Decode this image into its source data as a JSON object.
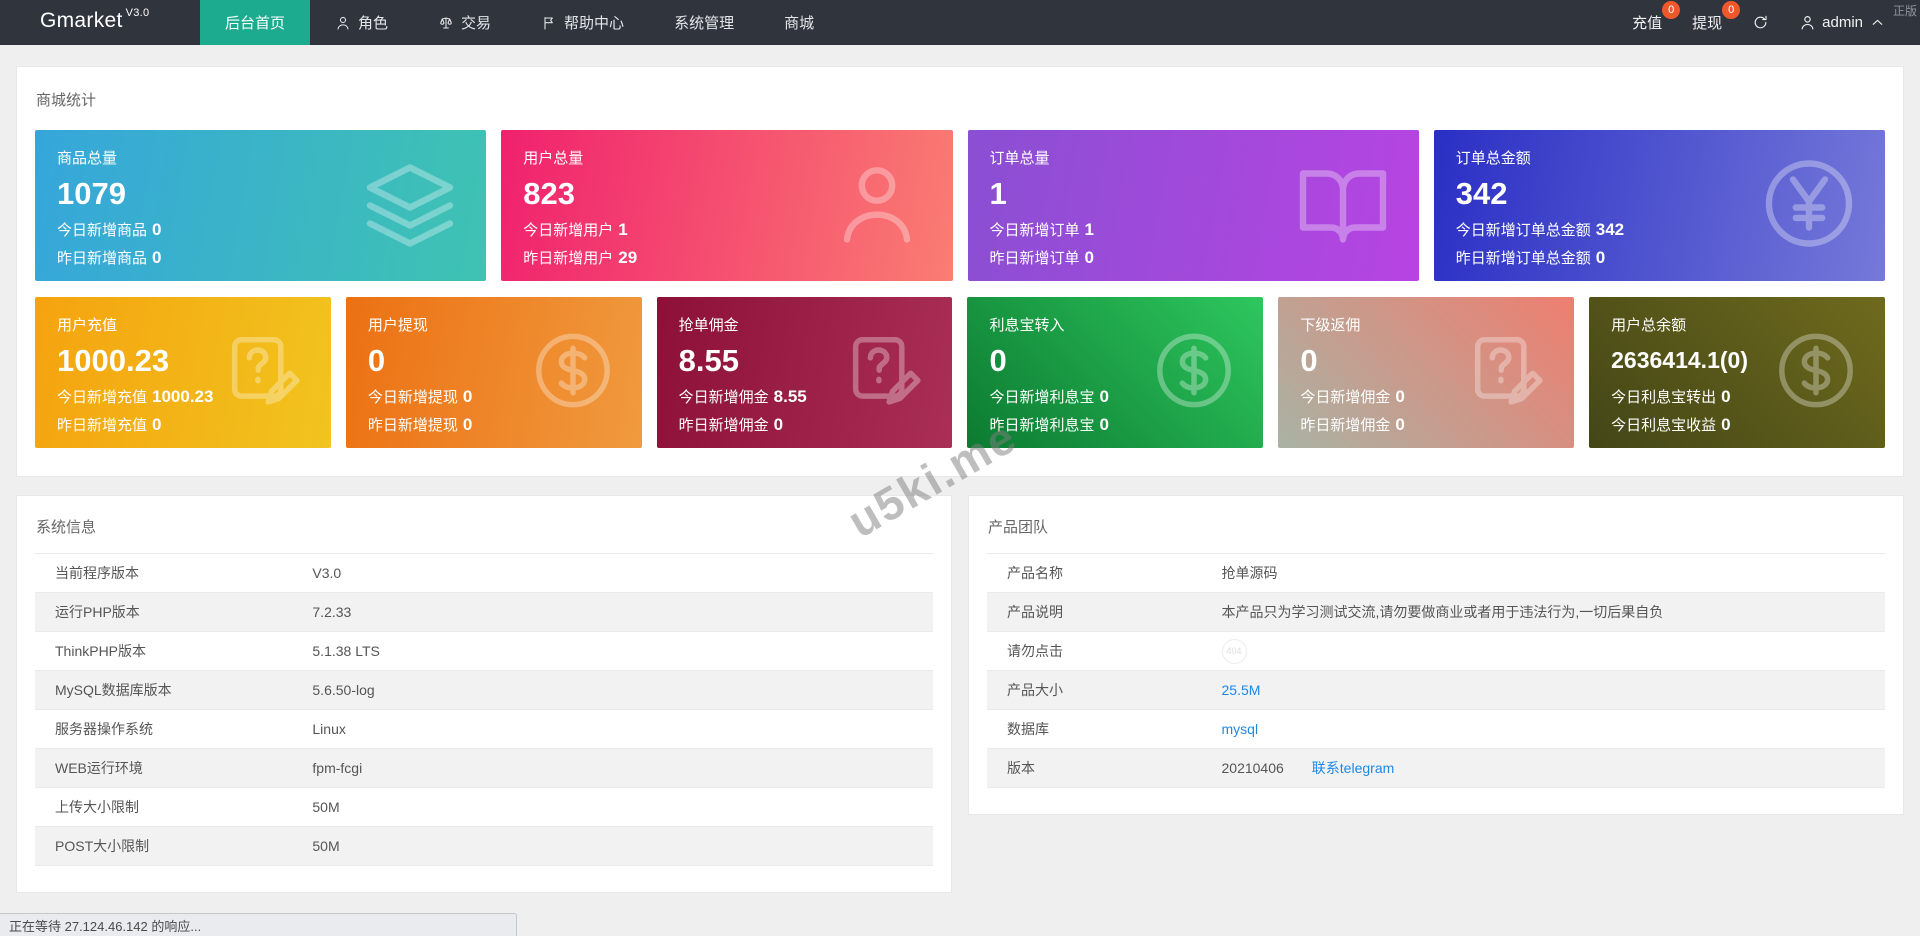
{
  "navbar": {
    "brand": "Gmarket",
    "version": "V3.0",
    "items": [
      {
        "label": "后台首页",
        "icon": null,
        "active": true
      },
      {
        "label": "角色",
        "icon": "user-icon",
        "active": false
      },
      {
        "label": "交易",
        "icon": "scales-icon",
        "active": false
      },
      {
        "label": "帮助中心",
        "icon": "flag-icon",
        "active": false
      },
      {
        "label": "系统管理",
        "icon": null,
        "active": false
      },
      {
        "label": "商城",
        "icon": null,
        "active": false
      }
    ],
    "recharge_label": "充值",
    "recharge_badge": "0",
    "withdraw_label": "提现",
    "withdraw_badge": "0",
    "username": "admin",
    "corner_text": "正版"
  },
  "stats": {
    "title": "商城统计",
    "row1": [
      {
        "title": "商品总量",
        "value": "1079",
        "today_label": "今日新增商品",
        "today_value": "0",
        "yesterday_label": "昨日新增商品",
        "yesterday_value": "0",
        "icon": "layers-icon",
        "gradient": "linear-gradient(100deg,#36a6db,#3fc3b2)"
      },
      {
        "title": "用户总量",
        "value": "823",
        "today_label": "今日新增用户",
        "today_value": "1",
        "yesterday_label": "昨日新增用户",
        "yesterday_value": "29",
        "icon": "person-icon",
        "gradient": "linear-gradient(100deg,#f0216e,#fa7d72)"
      },
      {
        "title": "订单总量",
        "value": "1",
        "today_label": "今日新增订单",
        "today_value": "1",
        "yesterday_label": "昨日新增订单",
        "yesterday_value": "0",
        "icon": "book-icon",
        "gradient": "linear-gradient(100deg,#8a4fd3,#b744e2)"
      },
      {
        "title": "订单总金额",
        "value": "342",
        "today_label": "今日新增订单总金额",
        "today_value": "342",
        "yesterday_label": "昨日新增订单总金额",
        "yesterday_value": "0",
        "icon": "yen-circle-icon",
        "gradient": "linear-gradient(100deg,#2a2fc5,#7579d9)"
      }
    ],
    "row2": [
      {
        "title": "用户充值",
        "value": "1000.23",
        "today_label": "今日新增充值",
        "today_value": "1000.23",
        "yesterday_label": "昨日新增充值",
        "yesterday_value": "0",
        "icon": "clipboard-question-icon",
        "gradient": "linear-gradient(100deg,#f5a30f,#f1c41e)"
      },
      {
        "title": "用户提现",
        "value": "0",
        "today_label": "今日新增提现",
        "today_value": "0",
        "yesterday_label": "昨日新增提现",
        "yesterday_value": "0",
        "icon": "dollar-circle-icon",
        "gradient": "linear-gradient(100deg,#ec7113,#f09a3e)"
      },
      {
        "title": "抢单佣金",
        "value": "8.55",
        "today_label": "今日新增佣金",
        "today_value": "8.55",
        "yesterday_label": "昨日新增佣金",
        "yesterday_value": "0",
        "icon": "clipboard-question-icon",
        "gradient": "linear-gradient(100deg,#8c1038,#aa2f56)"
      },
      {
        "title": "利息宝转入",
        "value": "0",
        "today_label": "今日新增利息宝",
        "today_value": "0",
        "yesterday_label": "昨日新增利息宝",
        "yesterday_value": "0",
        "icon": "dollar-circle-icon",
        "gradient": "linear-gradient(45deg,#0c7a31,#2ec75e)"
      },
      {
        "title": "下级返佣",
        "value": "0",
        "today_label": "今日新增佣金",
        "today_value": "0",
        "yesterday_label": "昨日新增佣金",
        "yesterday_value": "0",
        "icon": "clipboard-question-icon",
        "gradient": "linear-gradient(45deg,#a9b3a4,#ee7e70)"
      },
      {
        "title": "用户总余额",
        "value": "2636414.1(0)",
        "today_label": "今日利息宝转出",
        "today_value": "0",
        "yesterday_label": "今日利息宝收益",
        "yesterday_value": "0",
        "icon": "dollar-circle-icon",
        "gradient": "linear-gradient(45deg,#434617,#6f6a1d)"
      }
    ]
  },
  "system_info": {
    "title": "系统信息",
    "rows": [
      {
        "label": "当前程序版本",
        "value": "V3.0",
        "type": "text"
      },
      {
        "label": "运行PHP版本",
        "value": "7.2.33",
        "type": "text"
      },
      {
        "label": "ThinkPHP版本",
        "value": "5.1.38 LTS",
        "type": "text"
      },
      {
        "label": "MySQL数据库版本",
        "value": "5.6.50-log",
        "type": "text"
      },
      {
        "label": "服务器操作系统",
        "value": "Linux",
        "type": "text"
      },
      {
        "label": "WEB运行环境",
        "value": "fpm-fcgi",
        "type": "text"
      },
      {
        "label": "上传大小限制",
        "value": "50M",
        "type": "text"
      },
      {
        "label": "POST大小限制",
        "value": "50M",
        "type": "text"
      }
    ]
  },
  "product_team": {
    "title": "产品团队",
    "rows": [
      {
        "label": "产品名称",
        "value": "抢单源码",
        "type": "text"
      },
      {
        "label": "产品说明",
        "value": "本产品只为学习测试交流,请勿要做商业或者用于违法行为,一切后果自负",
        "type": "text"
      },
      {
        "label": "请勿点击",
        "value": "404",
        "type": "badge"
      },
      {
        "label": "产品大小",
        "value": "25.5M",
        "type": "link"
      },
      {
        "label": "数据库",
        "value": "mysql",
        "type": "link"
      },
      {
        "label": "版本",
        "value": "20210406",
        "link": "联系telegram",
        "type": "text-link"
      }
    ]
  },
  "watermark": "u5ki.me",
  "status_bar": "正在等待 27.124.46.142 的响应...",
  "colors": {
    "navbar": "#30343d",
    "active_nav": "#1cab8f",
    "badge": "#f0582b",
    "link": "#1e88e5",
    "page_bg": "#efefef"
  }
}
